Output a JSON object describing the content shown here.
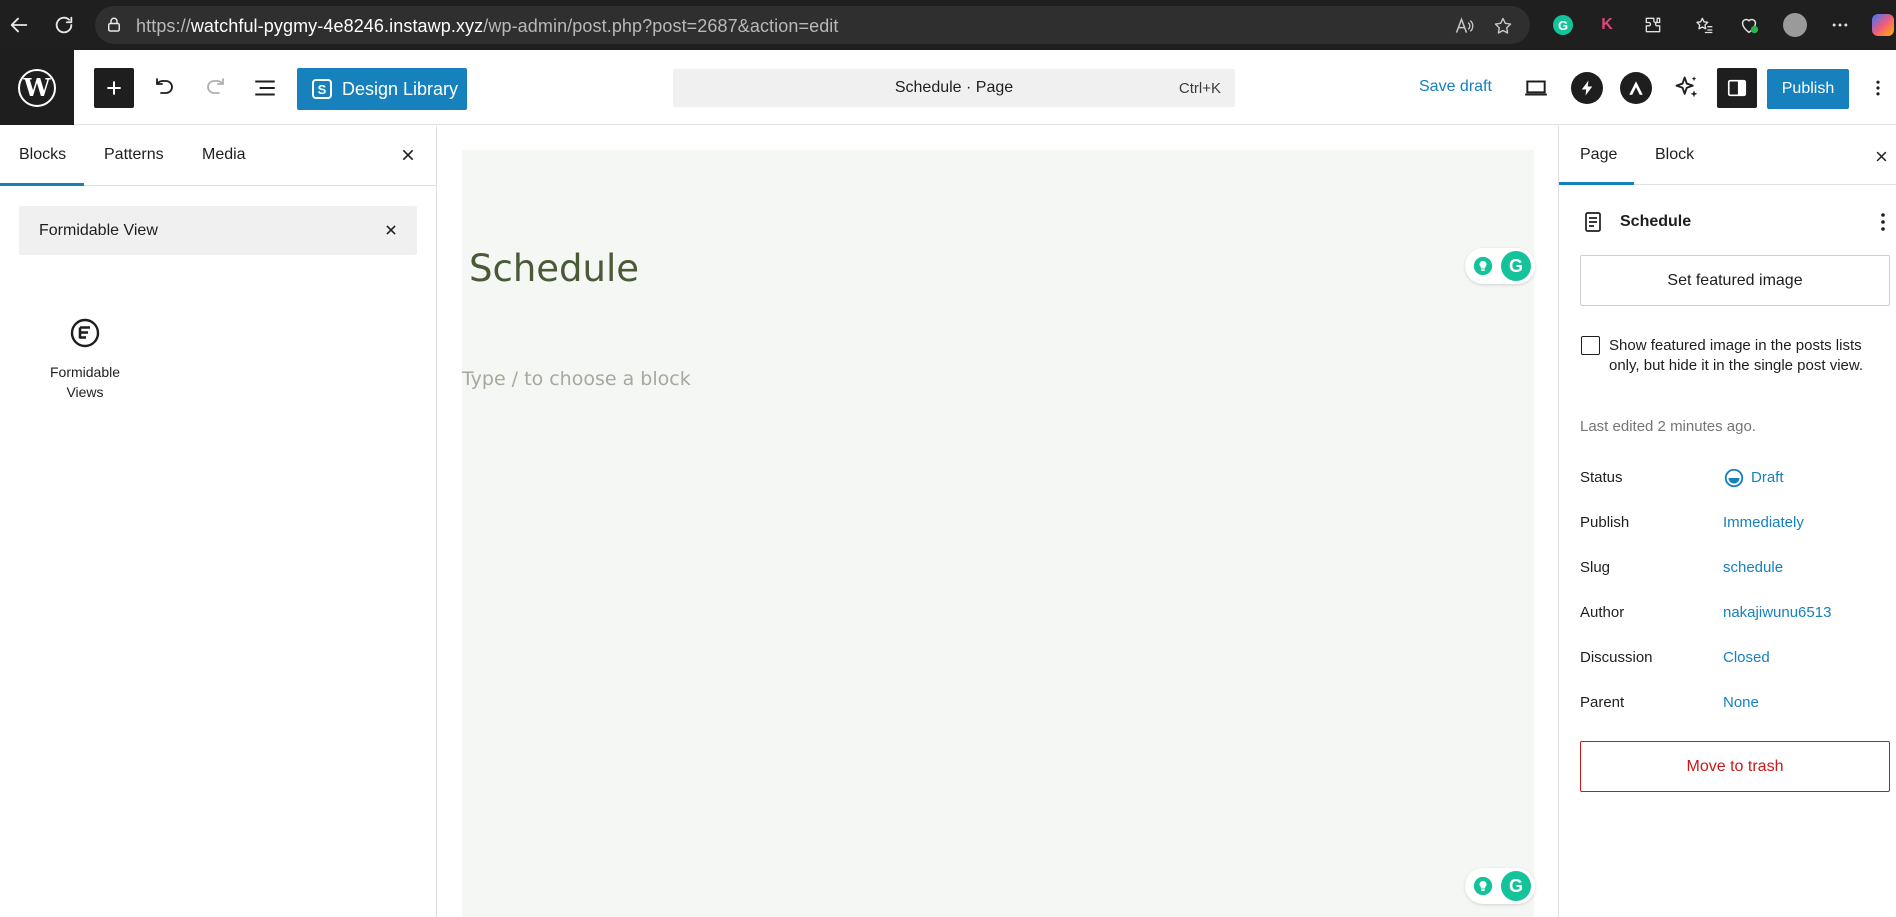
{
  "browser": {
    "url_prefix": "https://",
    "url_host": "watchful-pygmy-4e8246.instawp.xyz",
    "url_path": "/wp-admin/post.php?post=2687&action=edit",
    "extension_k_label": "K"
  },
  "toolbar": {
    "design_library_label": "Design Library",
    "command_title": "Schedule · Page",
    "command_shortcut": "Ctrl+K",
    "save_draft_label": "Save draft",
    "publish_label": "Publish"
  },
  "inserter": {
    "tabs": [
      {
        "label": "Blocks"
      },
      {
        "label": "Patterns"
      },
      {
        "label": "Media"
      }
    ],
    "search_value": "Formidable View",
    "results": [
      {
        "label_line1": "Formidable",
        "label_line2": "Views"
      }
    ]
  },
  "canvas": {
    "page_title": "Schedule",
    "block_placeholder": "Type / to choose a block"
  },
  "settings": {
    "tabs": [
      {
        "label": "Page"
      },
      {
        "label": "Block"
      }
    ],
    "doc_title": "Schedule",
    "featured_image_label": "Set featured image",
    "checkbox_label": "Show featured image in the posts lists only, but hide it in the single post view.",
    "last_edited": "Last edited 2 minutes ago.",
    "meta": [
      {
        "label": "Status",
        "value": "Draft"
      },
      {
        "label": "Publish",
        "value": "Immediately"
      },
      {
        "label": "Slug",
        "value": "schedule"
      },
      {
        "label": "Author",
        "value": "nakajiwunu6513"
      },
      {
        "label": "Discussion",
        "value": "Closed"
      },
      {
        "label": "Parent",
        "value": "None"
      }
    ],
    "trash_label": "Move to trash"
  },
  "colors": {
    "accent": "#1681bd",
    "danger": "#cc1818",
    "title_green": "#4a5a37",
    "grammarly": "#15c39a"
  }
}
